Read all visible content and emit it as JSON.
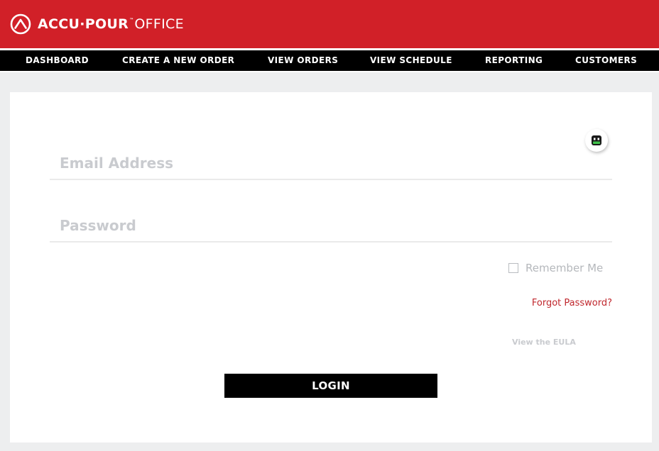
{
  "app": {
    "brand": "ACCU·POUR",
    "trademark": "™",
    "product": "OFFICE",
    "logo_icon": "accu-pour-logo-icon"
  },
  "nav": {
    "items": [
      {
        "label": "DASHBOARD"
      },
      {
        "label": "CREATE A NEW ORDER"
      },
      {
        "label": "VIEW ORDERS"
      },
      {
        "label": "VIEW SCHEDULE"
      },
      {
        "label": "REPORTING"
      },
      {
        "label": "CUSTOMERS"
      }
    ]
  },
  "login": {
    "email_placeholder": "Email Address",
    "email_value": "",
    "password_placeholder": "Password",
    "password_value": "",
    "remember_label": "Remember Me",
    "remember_checked": false,
    "forgot_label": "Forgot Password?",
    "eula_label": "View the EULA",
    "login_button": "LOGIN",
    "password_manager_icon": "password-manager-icon"
  },
  "colors": {
    "brand_red": "#d12028",
    "nav_black": "#000000",
    "link_red": "#c0272d",
    "page_bg": "#edeeef"
  }
}
